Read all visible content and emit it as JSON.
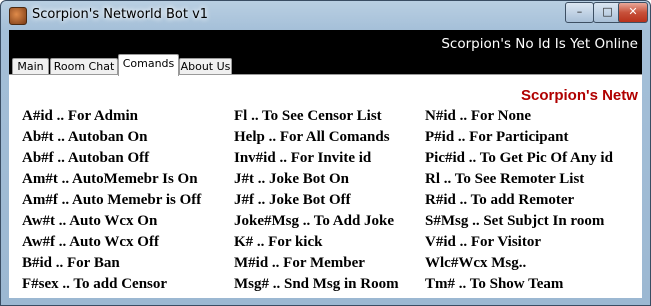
{
  "window": {
    "title": "Scorpion's Networld Bot v1",
    "controls": {
      "minimize": "–",
      "maximize": "□",
      "close": "✕"
    },
    "icon": "app-icon"
  },
  "status": {
    "text": "Scorpion's No Id Is Yet Online"
  },
  "tabs": [
    {
      "label": "Main",
      "active": false
    },
    {
      "label": "Room Chat",
      "active": false
    },
    {
      "label": "Comands",
      "active": true
    },
    {
      "label": "About Us",
      "active": false
    }
  ],
  "commands": {
    "banner": "Scorpion's Netw",
    "columns": [
      [
        "A#id .. For Admin",
        "Ab#t .. Autoban On",
        "Ab#f .. Autoban Off",
        "Am#t .. AutoMemebr Is On",
        "Am#f .. Auto Memebr is Off",
        "Aw#t .. Auto Wcx On",
        "Aw#f .. Auto Wcx Off",
        "B#id .. For Ban",
        "F#sex .. To add Censor"
      ],
      [
        "Fl .. To See Censor List",
        "Help .. For All Comands",
        "Inv#id .. For Invite id",
        "J#t .. Joke Bot On",
        "J#f .. Joke Bot Off",
        "Joke#Msg .. To Add Joke",
        "K# .. For kick",
        "M#id .. For Member",
        "Msg# .. Snd Msg in Room"
      ],
      [
        "N#id .. For None",
        "P#id .. For Participant",
        "Pic#id .. To Get Pic Of Any id",
        "Rl .. To See Remoter List",
        "R#id .. To add Remoter",
        "S#Msg .. Set Subjct In room",
        "V#id .. For Visitor",
        "Wlc#Wcx Msg..",
        "Tm# .. To Show Team"
      ]
    ]
  },
  "colors": {
    "banner": "#b00000",
    "titlebar": "#a4bfd8",
    "header_background": "#000000"
  }
}
